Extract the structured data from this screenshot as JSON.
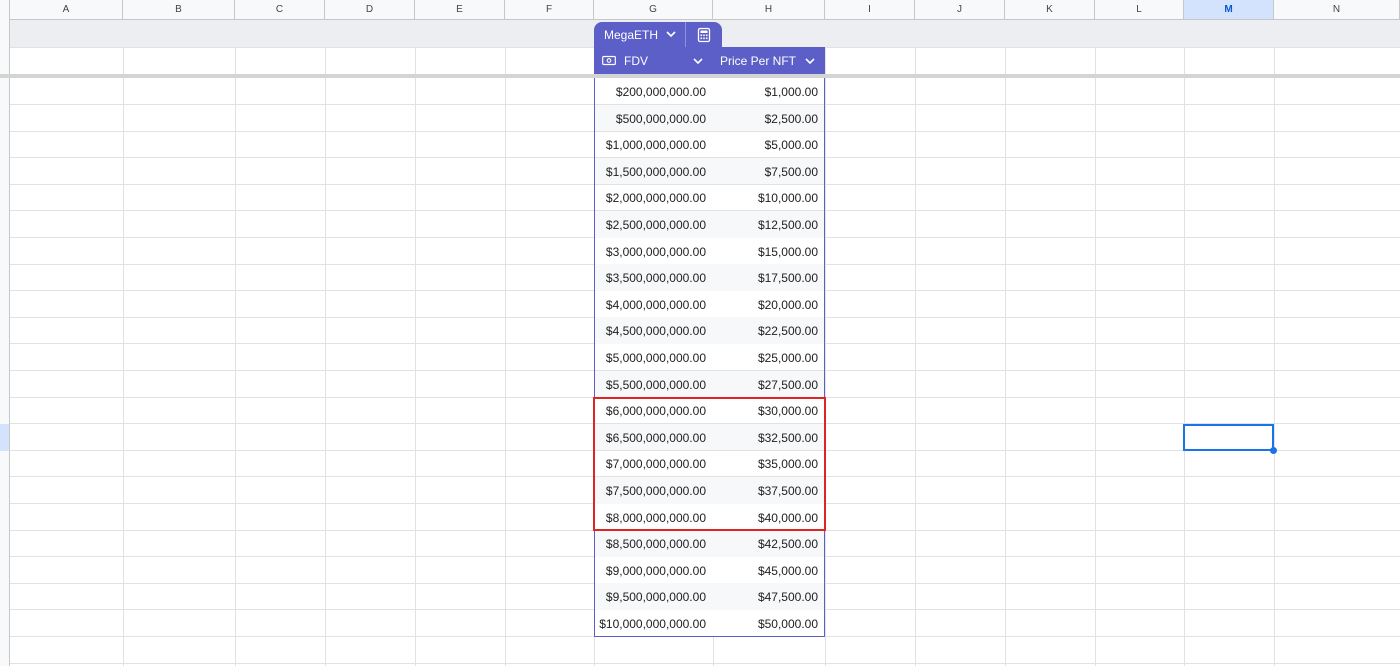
{
  "columns": [
    "A",
    "B",
    "C",
    "D",
    "E",
    "F",
    "G",
    "H",
    "I",
    "J",
    "K",
    "L",
    "M",
    "N"
  ],
  "selected_column": "M",
  "table": {
    "name": "MegaETH",
    "columns": [
      {
        "label": "FDV",
        "icon": "currency-column-icon"
      },
      {
        "label": "Price Per NFT"
      }
    ],
    "rows": [
      {
        "fdv": "$200,000,000.00",
        "price": "$1,000.00"
      },
      {
        "fdv": "$500,000,000.00",
        "price": "$2,500.00"
      },
      {
        "fdv": "$1,000,000,000.00",
        "price": "$5,000.00"
      },
      {
        "fdv": "$1,500,000,000.00",
        "price": "$7,500.00"
      },
      {
        "fdv": "$2,000,000,000.00",
        "price": "$10,000.00"
      },
      {
        "fdv": "$2,500,000,000.00",
        "price": "$12,500.00"
      },
      {
        "fdv": "$3,000,000,000.00",
        "price": "$15,000.00"
      },
      {
        "fdv": "$3,500,000,000.00",
        "price": "$17,500.00"
      },
      {
        "fdv": "$4,000,000,000.00",
        "price": "$20,000.00"
      },
      {
        "fdv": "$4,500,000,000.00",
        "price": "$22,500.00"
      },
      {
        "fdv": "$5,000,000,000.00",
        "price": "$25,000.00"
      },
      {
        "fdv": "$5,500,000,000.00",
        "price": "$27,500.00"
      },
      {
        "fdv": "$6,000,000,000.00",
        "price": "$30,000.00",
        "highlighted": true
      },
      {
        "fdv": "$6,500,000,000.00",
        "price": "$32,500.00",
        "highlighted": true
      },
      {
        "fdv": "$7,000,000,000.00",
        "price": "$35,000.00",
        "highlighted": true
      },
      {
        "fdv": "$7,500,000,000.00",
        "price": "$37,500.00",
        "highlighted": true
      },
      {
        "fdv": "$8,000,000,000.00",
        "price": "$40,000.00",
        "highlighted": true
      },
      {
        "fdv": "$8,500,000,000.00",
        "price": "$42,500.00"
      },
      {
        "fdv": "$9,000,000,000.00",
        "price": "$45,000.00"
      },
      {
        "fdv": "$9,500,000,000.00",
        "price": "$47,500.00"
      },
      {
        "fdv": "$10,000,000,000.00",
        "price": "$50,000.00"
      }
    ]
  },
  "colors": {
    "table_accent": "#5b5fc7",
    "highlight_border": "#e02424",
    "selection": "#1a73e8"
  }
}
